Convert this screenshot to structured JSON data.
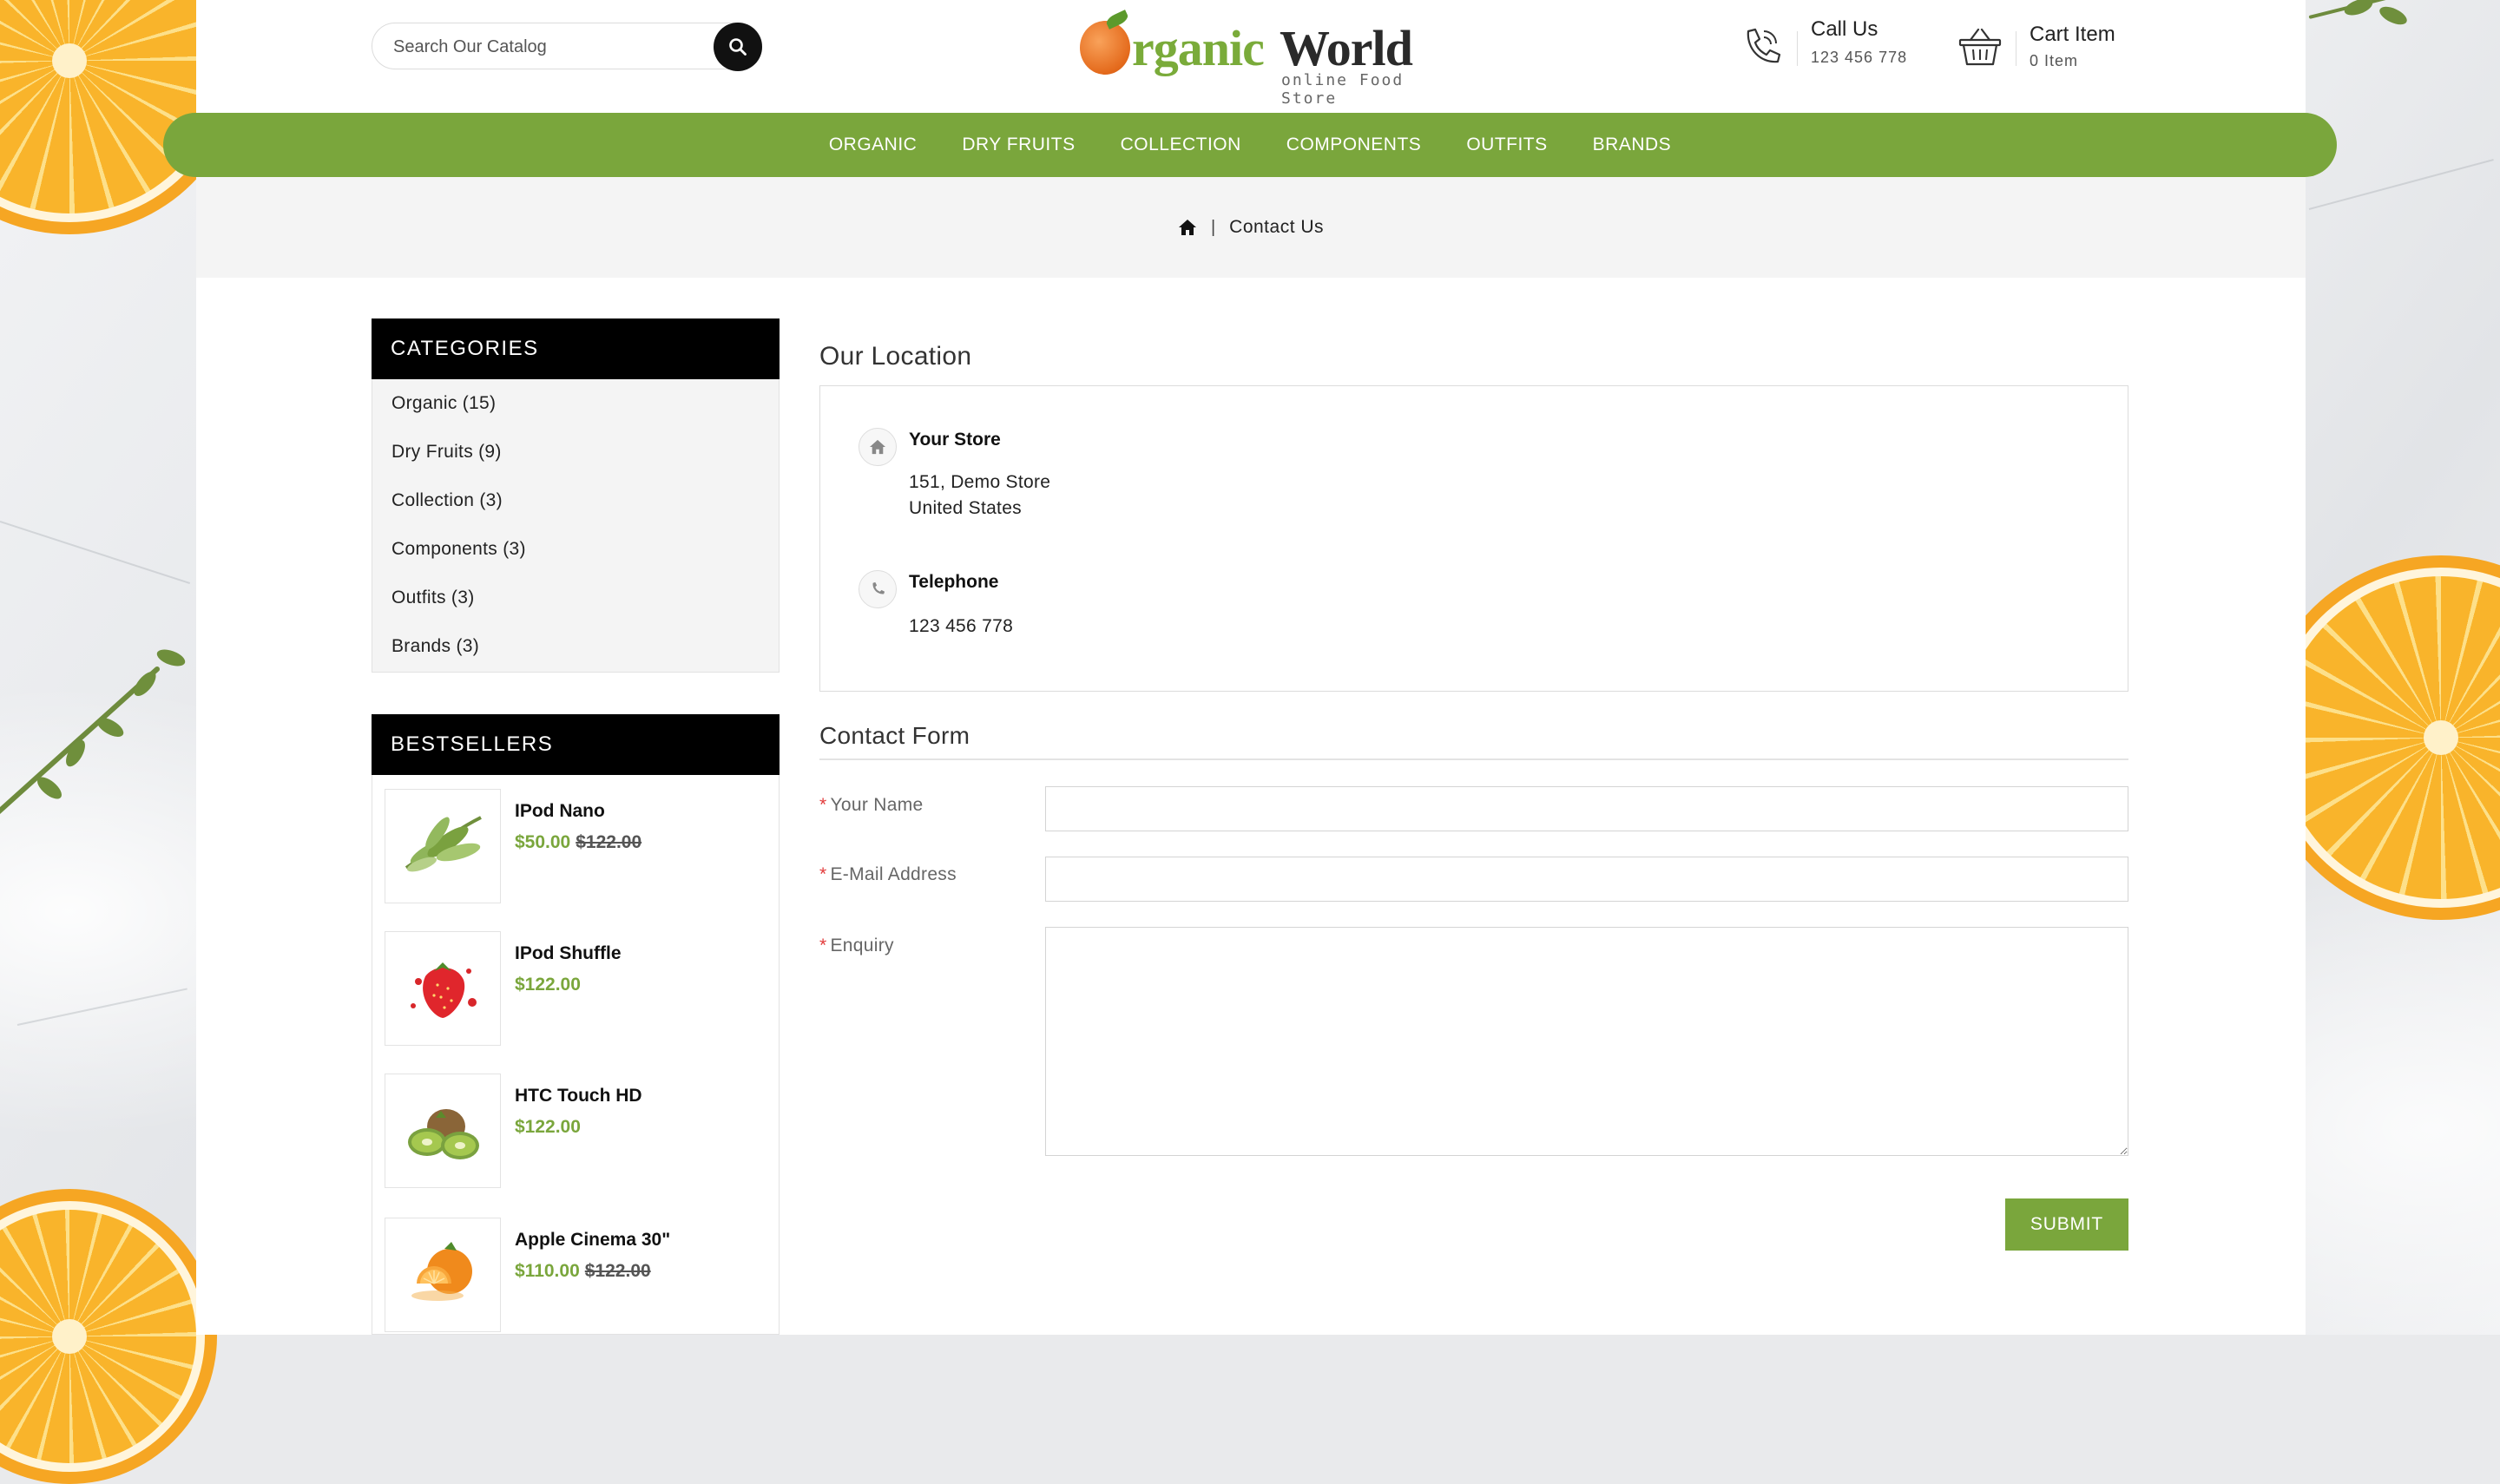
{
  "search": {
    "placeholder": "Search Our Catalog"
  },
  "logo": {
    "first_letter": "O",
    "part1": "rganic",
    "part2": "World",
    "tagline": "online Food Store"
  },
  "contact": {
    "title": "Call Us",
    "phone": "123 456 778"
  },
  "cart": {
    "title": "Cart Item",
    "count": "0 Item"
  },
  "nav": {
    "items": [
      "ORGANIC",
      "DRY FRUITS",
      "COLLECTION",
      "COMPONENTS",
      "OUTFITS",
      "BRANDS"
    ]
  },
  "breadcrumb": {
    "separator": "|",
    "current": "Contact Us"
  },
  "categories": {
    "heading": "CATEGORIES",
    "items": [
      "Organic (15)",
      "Dry Fruits (9)",
      "Collection (3)",
      "Components (3)",
      "Outfits (3)",
      "Brands (3)"
    ]
  },
  "bestsellers": {
    "heading": "BESTSELLERS",
    "items": [
      {
        "name": "IPod Nano",
        "price": "$50.00",
        "old_price": "$122.00",
        "image": "leafy-greens"
      },
      {
        "name": "IPod Shuffle",
        "price": "$122.00",
        "old_price": "",
        "image": "strawberry-splash"
      },
      {
        "name": "HTC Touch HD",
        "price": "$122.00",
        "old_price": "",
        "image": "kiwi"
      },
      {
        "name": "Apple Cinema 30\"",
        "price": "$110.00",
        "old_price": "$122.00",
        "image": "orange"
      }
    ]
  },
  "location": {
    "heading": "Our Location",
    "store_title": "Your Store",
    "address_line1": "151, Demo Store",
    "address_line2": "United States",
    "telephone_title": "Telephone",
    "telephone": "123 456 778"
  },
  "form": {
    "heading": "Contact Form",
    "required_mark": "*",
    "name_label": "Your Name",
    "email_label": "E-Mail Address",
    "enquiry_label": "Enquiry",
    "submit_label": "SUBMIT"
  },
  "colors": {
    "accent": "#7aa63c",
    "dark": "#000000",
    "required": "#e23b3b"
  }
}
